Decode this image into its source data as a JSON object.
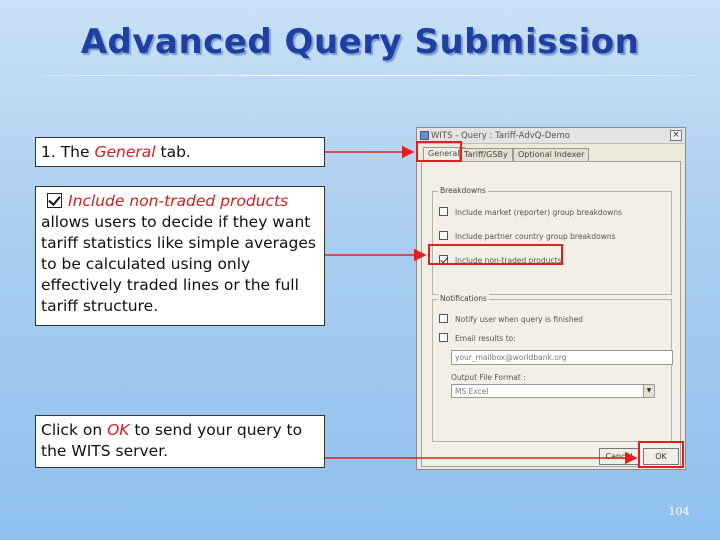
{
  "slide": {
    "title": "Advanced Query Submission",
    "page_number": "104"
  },
  "callouts": {
    "general": {
      "prefix": "1. The ",
      "emphasis": "General",
      "suffix": " tab."
    },
    "traded": {
      "emphasis": "Include non-traded products",
      "body": "allows users to decide if they want tariff statistics like simple averages to be calculated using only effectively traded lines or the full tariff structure."
    },
    "ok": {
      "prefix": "Click on ",
      "emphasis": "OK",
      "suffix": " to send your query to the WITS server."
    }
  },
  "dialog": {
    "title": "WITS - Query : Tariff-AdvQ-Demo",
    "close_label": "×",
    "tabs": [
      {
        "label": "General",
        "active": true
      },
      {
        "label": "Tariff/GSBy",
        "active": false
      },
      {
        "label": "Optional Indexer",
        "active": false
      }
    ],
    "breakdowns": {
      "label": "Breakdowns",
      "options": [
        {
          "label": "Include market (reporter) group breakdowns",
          "checked": false
        },
        {
          "label": "Include partner country group breakdowns",
          "checked": false
        },
        {
          "label": "Include non-traded products",
          "checked": true
        }
      ]
    },
    "notifications": {
      "label": "Notifications",
      "notify_label": "Notify user when query is finished",
      "notify_checked": false,
      "email_label": "Email results to:",
      "email_checked": false,
      "email_value": "your_mailbox@worldbank.org",
      "output_format_label": "Output File Format :",
      "output_format_value": "MS Excel"
    },
    "cancel_label": "Cancel",
    "ok_label": "OK"
  },
  "colors": {
    "title": "#1f3fa3",
    "highlight": "#e02020",
    "emphasis": "#cc2222"
  }
}
